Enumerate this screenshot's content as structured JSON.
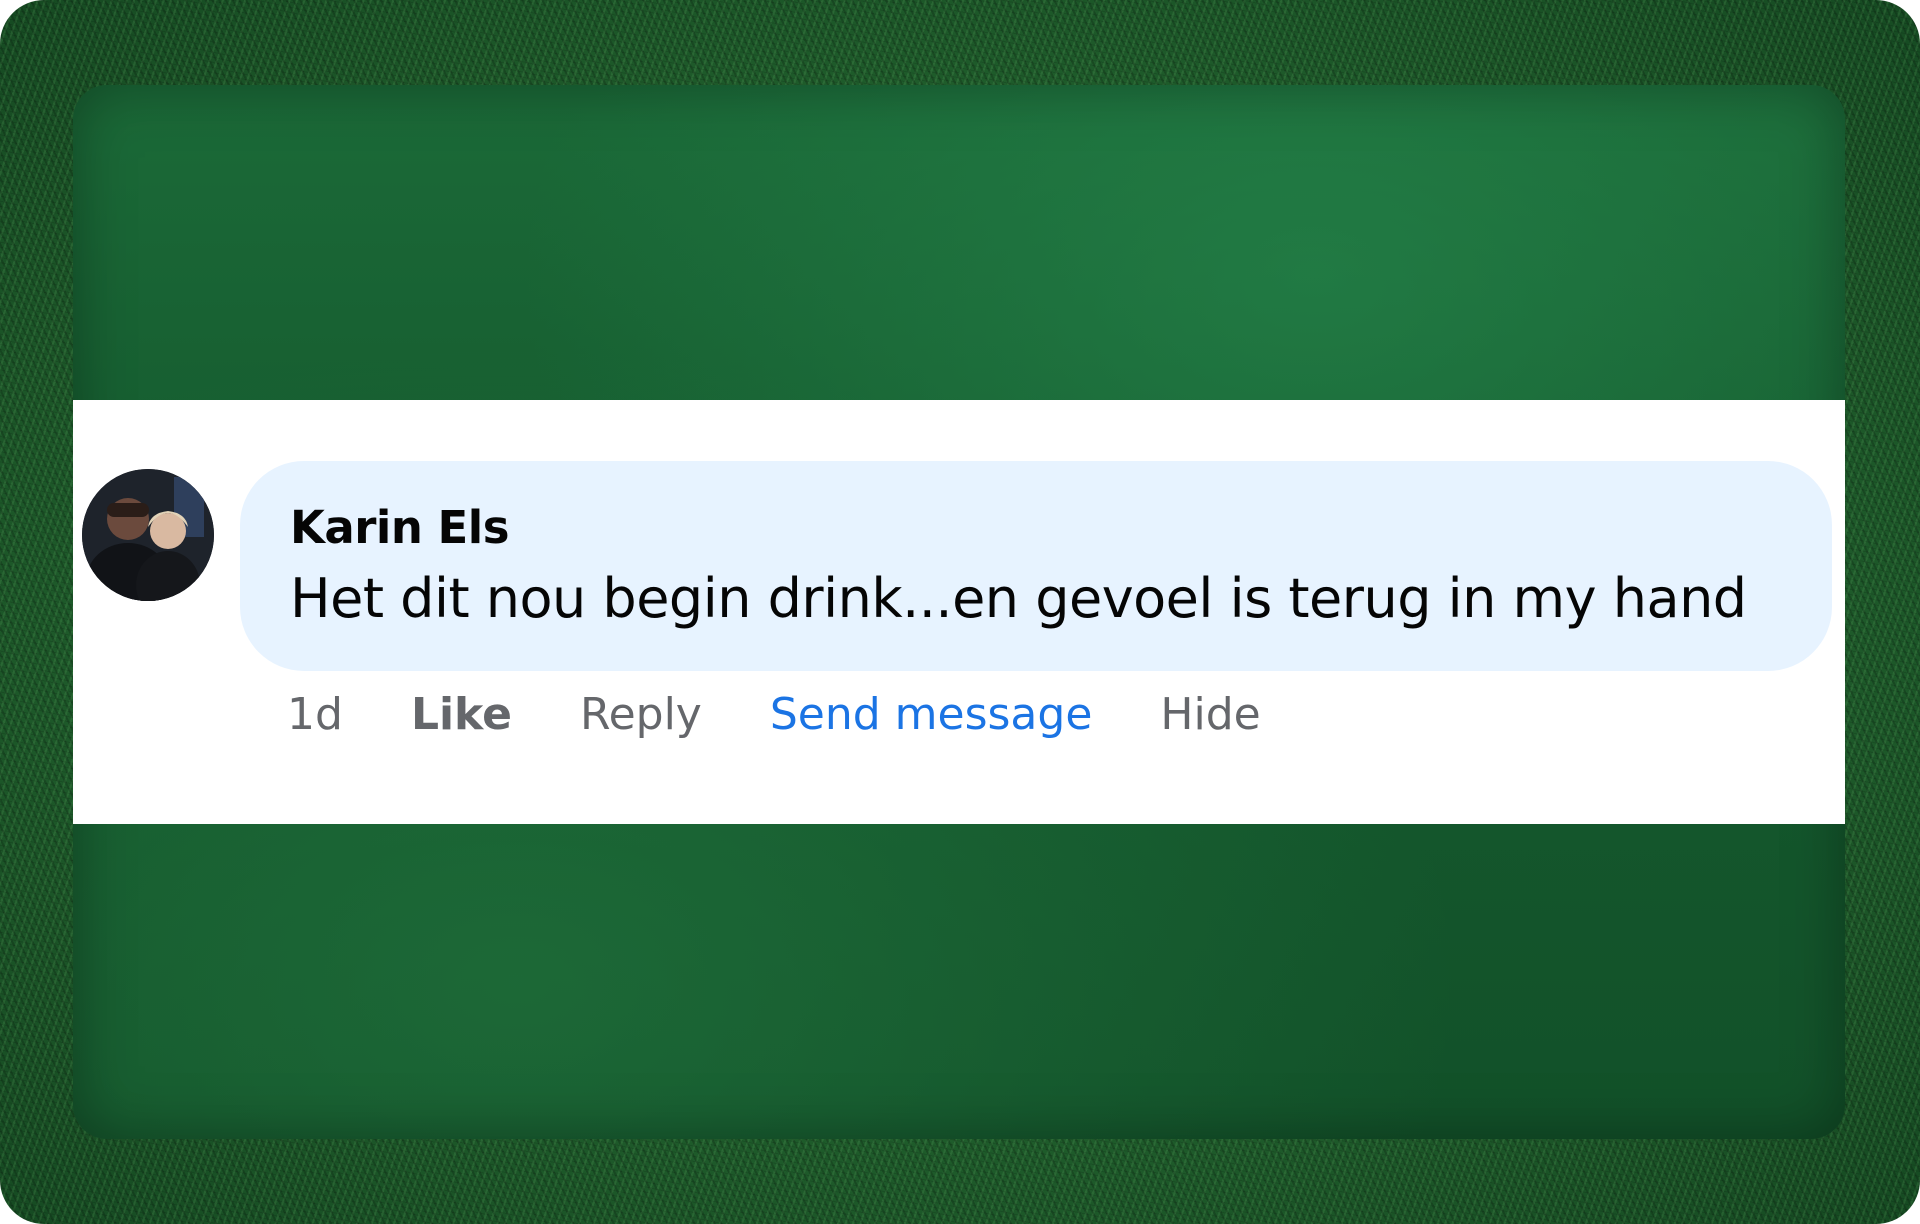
{
  "comment": {
    "author": "Karin Els",
    "text": "Het dit nou begin drink...en gevoel is terug in my hand",
    "avatar_icon": "avatar-photo"
  },
  "actions": {
    "timestamp": "1d",
    "like_label": "Like",
    "reply_label": "Reply",
    "send_message_label": "Send message",
    "hide_label": "Hide"
  },
  "colors": {
    "bubble": "#e7f3ff",
    "link_blue": "#1b74e4",
    "muted_gray": "#65676b",
    "text": "#050505",
    "background_green": "#1b6a38"
  }
}
